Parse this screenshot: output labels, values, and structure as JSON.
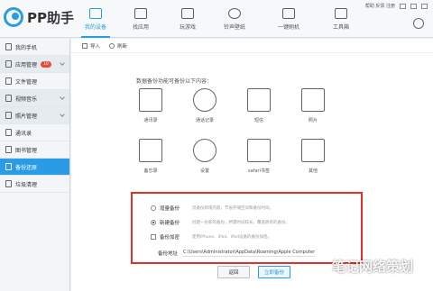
{
  "app": {
    "logo_text": "PP助手"
  },
  "title_tools": {
    "feedback": "帮助 反馈 注册"
  },
  "nav": [
    {
      "label": "我的设备",
      "active": true,
      "icon": "device-icon"
    },
    {
      "label": "找应用",
      "active": false,
      "icon": "app-store-icon"
    },
    {
      "label": "玩游戏",
      "active": false,
      "icon": "gamepad-icon"
    },
    {
      "label": "铃声壁纸",
      "active": false,
      "icon": "ringtone-icon"
    },
    {
      "label": "一键刷机",
      "active": false,
      "icon": "flash-icon"
    },
    {
      "label": "工具箱",
      "active": false,
      "icon": "toolbox-icon"
    }
  ],
  "sidebar": {
    "items": [
      {
        "label": "我的手机",
        "icon": "phone-icon"
      },
      {
        "label": "应用管理",
        "icon": "apps-icon",
        "badge": "10"
      },
      {
        "label": "文件管理",
        "icon": "folder-icon"
      },
      {
        "label": "视频音乐",
        "icon": "media-icon"
      },
      {
        "label": "照片管理",
        "icon": "photo-icon"
      },
      {
        "label": "通讯录",
        "icon": "contacts-icon"
      },
      {
        "label": "图书管理",
        "icon": "book-icon"
      },
      {
        "label": "备份还原",
        "icon": "backup-icon",
        "active": true
      },
      {
        "label": "垃圾清理",
        "icon": "trash-icon"
      }
    ]
  },
  "toolbar": {
    "import_label": "导入",
    "refresh_label": "刷新"
  },
  "backup": {
    "section_title": "数据备份功能可备份以下内容：",
    "tiles": [
      {
        "label": "通讯录",
        "icon": "contacts-book-icon"
      },
      {
        "label": "通话记录",
        "icon": "call-log-icon"
      },
      {
        "label": "短信",
        "icon": "sms-icon"
      },
      {
        "label": "照片",
        "icon": "image-icon"
      },
      {
        "label": "备忘录",
        "icon": "memo-icon"
      },
      {
        "label": "设置",
        "icon": "settings-gear-icon"
      },
      {
        "label": "safari书签",
        "icon": "bookmark-icon"
      },
      {
        "label": "其他",
        "icon": "more-icon"
      }
    ],
    "options": {
      "incremental": {
        "label": "增量备份",
        "desc": "仅备份新增内容，节省存储空间和备份时间。"
      },
      "new": {
        "label": "新建备份",
        "desc": "创建一份新的备份，所需时间较长，覆盖原有的备份。",
        "checked": true
      },
      "encrypt": {
        "label": "备份加密",
        "desc": "使用iPhone、iPad、iPod设备的备份加密。"
      },
      "path": {
        "label": "备份地址",
        "value": "C:\\Users\\Administrator\\AppData\\Roaming\\Apple Computer"
      }
    },
    "back_button": "返回",
    "start_button": "立即备份"
  },
  "watermark": "笔记网络策划"
}
